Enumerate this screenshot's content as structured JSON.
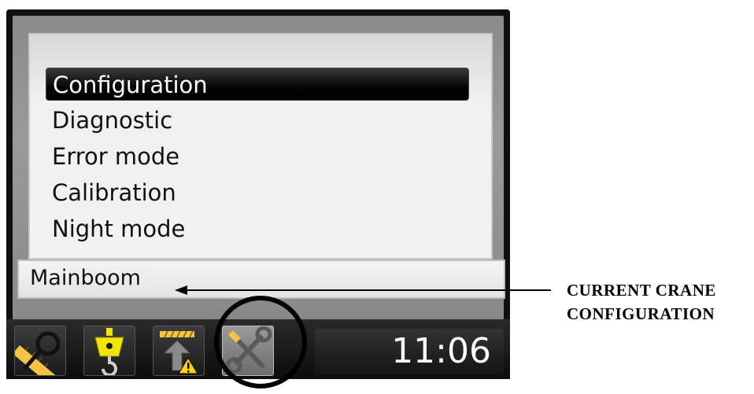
{
  "menu": {
    "items": [
      {
        "label": "Configuration",
        "selected": true
      },
      {
        "label": "Diagnostic",
        "selected": false
      },
      {
        "label": "Error mode",
        "selected": false
      },
      {
        "label": "Calibration",
        "selected": false
      },
      {
        "label": "Night mode",
        "selected": false
      }
    ]
  },
  "status": {
    "configuration_value": "Mainboom"
  },
  "toolbar": {
    "buttons": [
      {
        "icon": "measure-wrench-icon",
        "active": false
      },
      {
        "icon": "hook-icon",
        "active": false
      },
      {
        "icon": "lift-warning-icon",
        "active": false
      },
      {
        "icon": "tools-icon",
        "active": true
      }
    ],
    "clock": "11:06"
  },
  "callout": {
    "line1": "CURRENT CRANE",
    "line2": "CONFIGURATION"
  },
  "colors": {
    "selected_bg": "#000000",
    "hook_yellow": "#f2e600",
    "warning_yellow": "#ffd400",
    "ruler_yellow": "#f5c542"
  }
}
